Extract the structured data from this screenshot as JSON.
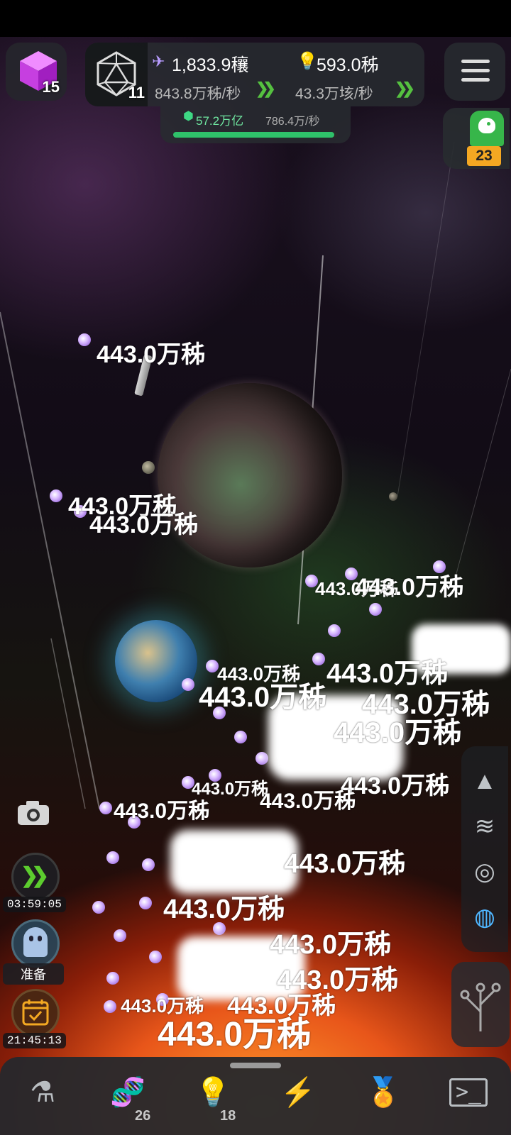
{
  "hud": {
    "cube_level": "15",
    "d20_level": "11",
    "energy": {
      "value": "1,833.9穰",
      "rate": "843.8万秭/秒"
    },
    "ideas": {
      "value": "593.0秭",
      "rate": "43.3万垓/秒"
    },
    "gem": {
      "value": "57.2万亿",
      "rate": "786.4万/秒",
      "progress": 0.98
    },
    "dino_count": "23"
  },
  "floating_value": "443.0万秭",
  "left_controls": {
    "speed_timer": "03:59:05",
    "ghost_label": "准备",
    "calendar_timer": "21:45:13"
  },
  "bottom_nav": [
    {
      "name": "lab",
      "icon": "flask-icon",
      "count": ""
    },
    {
      "name": "dna",
      "icon": "dna-icon",
      "count": "26"
    },
    {
      "name": "ideas",
      "icon": "lightbulb-icon",
      "count": "18"
    },
    {
      "name": "power",
      "icon": "lightning-icon",
      "count": ""
    },
    {
      "name": "achievements",
      "icon": "medal-icon",
      "count": ""
    },
    {
      "name": "terminal",
      "icon": "terminal-icon",
      "count": ""
    }
  ],
  "colors": {
    "accent_green": "#2fc16a",
    "arrow_green": "#55c040",
    "ship_purple": "#c9a4ff",
    "active_nav": "#4fb6ff"
  }
}
